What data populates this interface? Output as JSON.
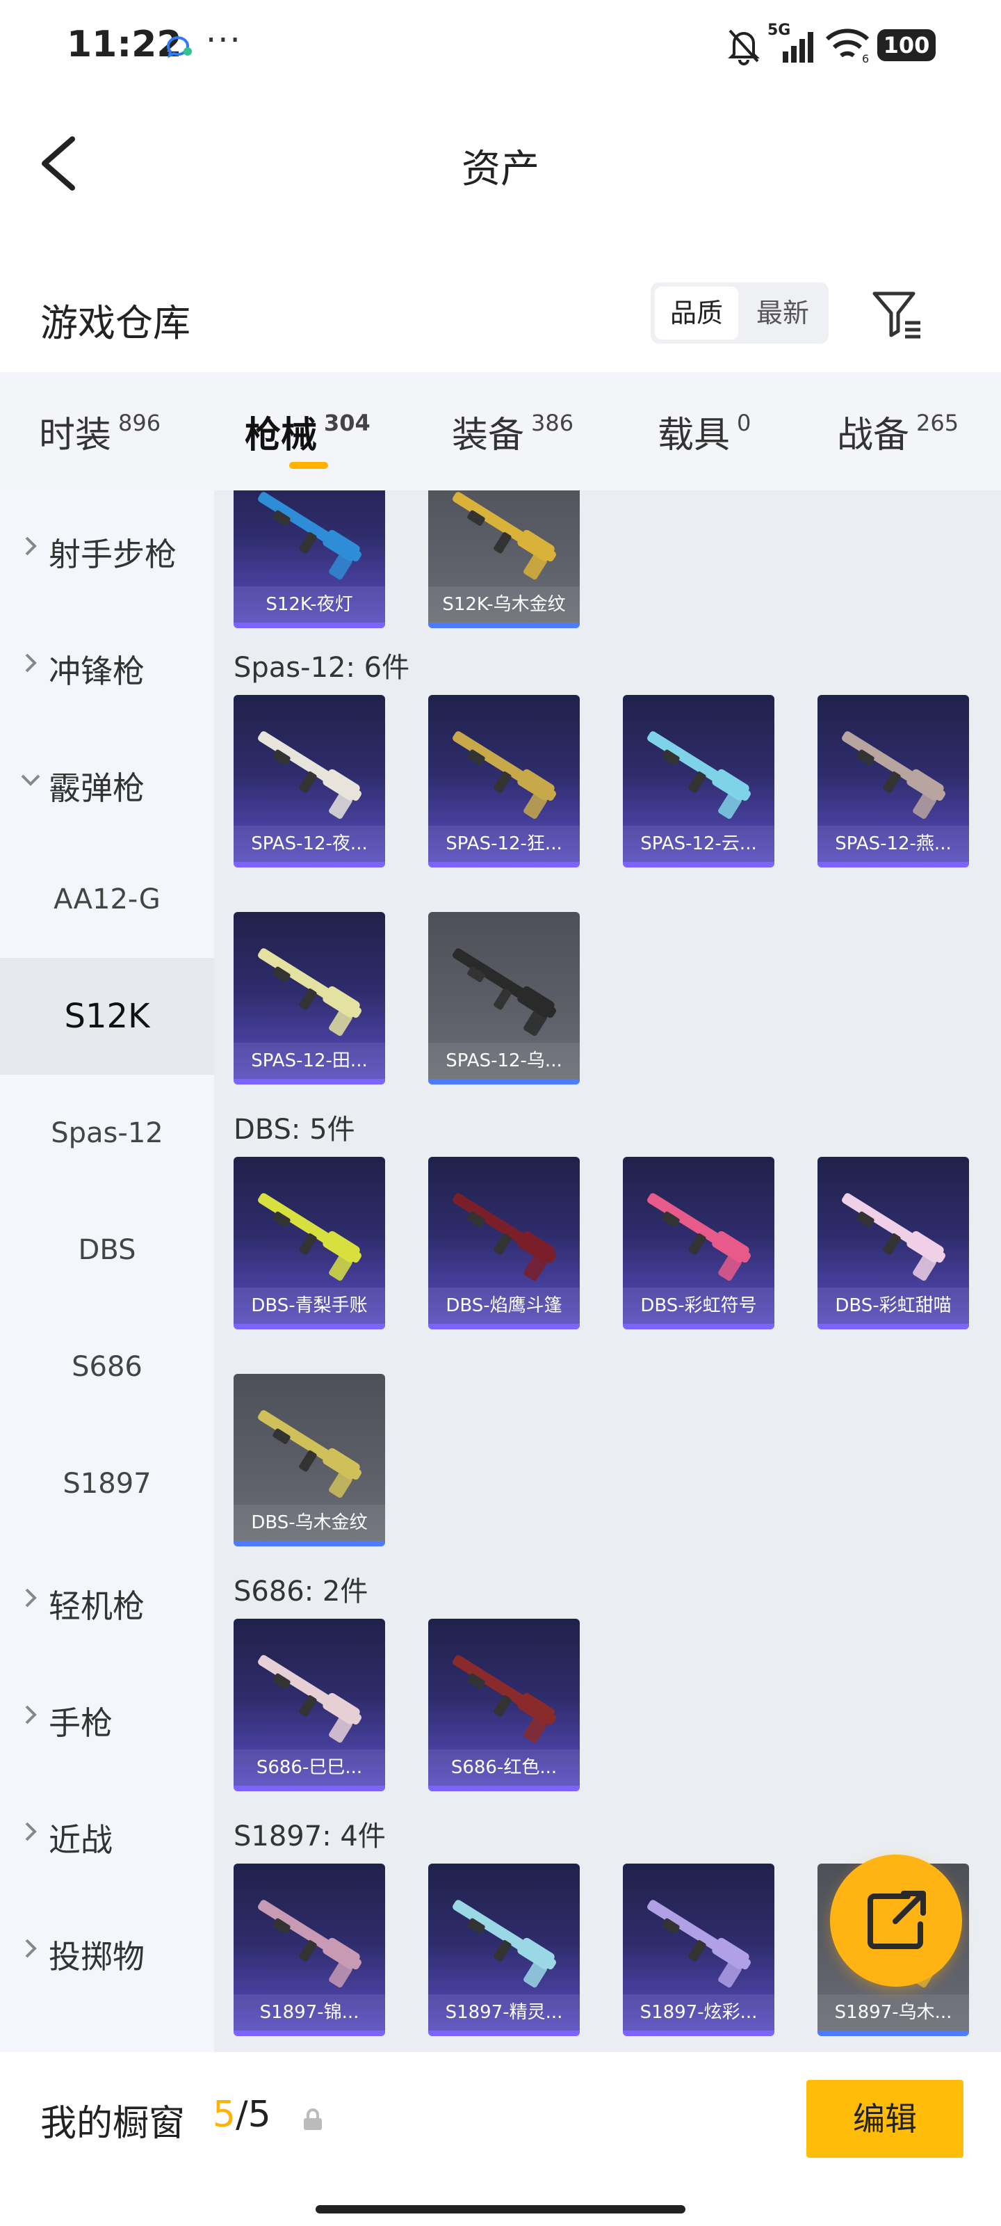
{
  "status": {
    "time": "11:22",
    "battery": "100",
    "network": "5G"
  },
  "nav": {
    "title": "资产"
  },
  "warehouse": {
    "title": "游戏仓库",
    "sort_quality": "品质",
    "sort_newest": "最新"
  },
  "categories": [
    {
      "label": "时装",
      "count": "896"
    },
    {
      "label": "枪械",
      "count": "304"
    },
    {
      "label": "装备",
      "count": "386"
    },
    {
      "label": "载具",
      "count": "0"
    },
    {
      "label": "战备",
      "count": "265"
    }
  ],
  "sidebar": {
    "top_groups": [
      {
        "label": "射手步枪"
      },
      {
        "label": "冲锋枪"
      },
      {
        "label": "霰弹枪"
      }
    ],
    "sub_items": [
      {
        "label": "AA12-G"
      },
      {
        "label": "S12K"
      },
      {
        "label": "Spas-12"
      },
      {
        "label": "DBS"
      },
      {
        "label": "S686"
      },
      {
        "label": "S1897"
      }
    ],
    "bottom_groups": [
      {
        "label": "轻机枪"
      },
      {
        "label": "手枪"
      },
      {
        "label": "近战"
      },
      {
        "label": "投掷物"
      }
    ]
  },
  "groups": [
    {
      "title": "",
      "items": [
        {
          "name": "S12K-夜灯"
        },
        {
          "name": "S12K-乌木金纹"
        }
      ]
    },
    {
      "title": "Spas-12: 6件",
      "items": [
        {
          "name": "SPAS-12-夜..."
        },
        {
          "name": "SPAS-12-狂..."
        },
        {
          "name": "SPAS-12-云..."
        },
        {
          "name": "SPAS-12-燕..."
        },
        {
          "name": "SPAS-12-田..."
        },
        {
          "name": "SPAS-12-乌..."
        }
      ]
    },
    {
      "title": "DBS: 5件",
      "items": [
        {
          "name": "DBS-青梨手账"
        },
        {
          "name": "DBS-焰鹰斗篷"
        },
        {
          "name": "DBS-彩虹符号"
        },
        {
          "name": "DBS-彩虹甜喵"
        },
        {
          "name": "DBS-乌木金纹"
        }
      ]
    },
    {
      "title": "S686: 2件",
      "items": [
        {
          "name": "S686-巳巳..."
        },
        {
          "name": "S686-红色..."
        }
      ]
    },
    {
      "title": "S1897: 4件",
      "items": [
        {
          "name": "S1897-锦..."
        },
        {
          "name": "S1897-精灵..."
        },
        {
          "name": "S1897-炫彩..."
        },
        {
          "name": "S1897-乌木..."
        }
      ]
    }
  ],
  "bottom": {
    "title": "我的橱窗",
    "count_current": "5",
    "count_sep": "/",
    "count_total": "5",
    "edit": "编辑"
  },
  "colors": {
    "accent": "#ffb300",
    "card_purple": "#5b4fc4",
    "card_gray": "#5b5d66"
  }
}
